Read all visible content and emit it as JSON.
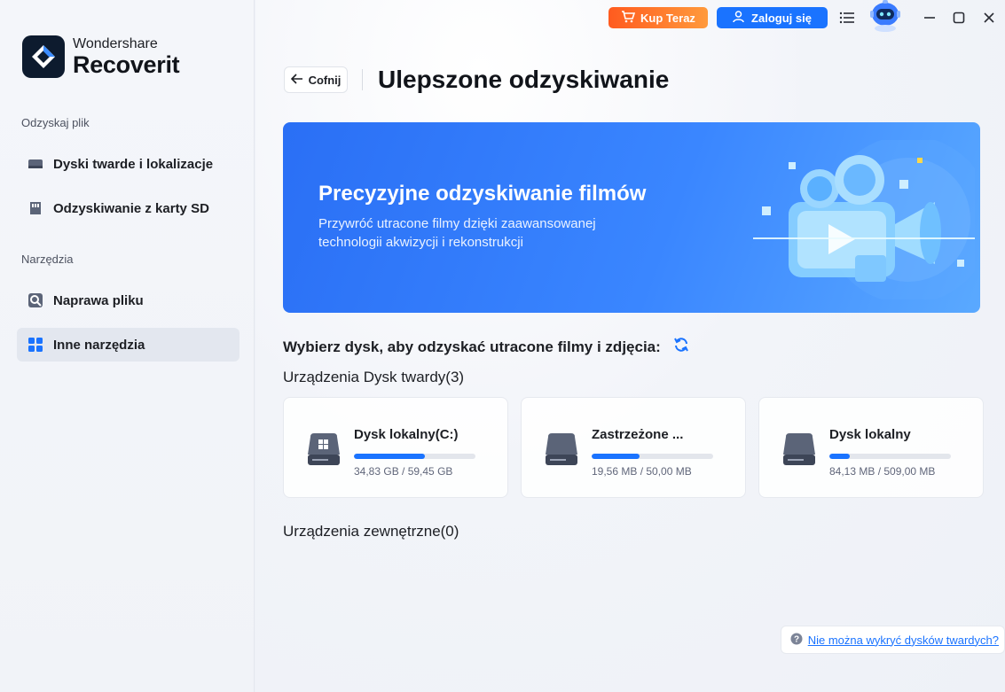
{
  "app": {
    "brand": "Wondershare",
    "product": "Recoverit"
  },
  "sidebar": {
    "section1": "Odzyskaj plik",
    "section2": "Narzędzia",
    "items": [
      {
        "label": "Dyski twarde i lokalizacje",
        "icon": "hard-drive-icon"
      },
      {
        "label": "Odzyskiwanie z karty SD",
        "icon": "sd-card-icon"
      },
      {
        "label": "Naprawa pliku",
        "icon": "file-repair-icon"
      },
      {
        "label": "Inne narzędzia",
        "icon": "grid-tools-icon",
        "active": true
      }
    ]
  },
  "topbar": {
    "buy_label": "Kup Teraz",
    "login_label": "Zaloguj się"
  },
  "header": {
    "back_label": "Cofnij",
    "title": "Ulepszone odzyskiwanie"
  },
  "banner": {
    "title": "Precyzyjne odzyskiwanie filmów",
    "subtitle": "Przywróć utracone filmy dzięki zaawansowanej technologii akwizycji i rekonstrukcji"
  },
  "main": {
    "select_prompt": "Wybierz dysk, aby odzyskać utracone filmy i zdjęcia:",
    "hdd_group": "Urządzenia Dysk twardy(3)",
    "external_group": "Urządzenia zewnętrzne(0)",
    "help_link": "Nie można wykryć dysków twardych?"
  },
  "disks": [
    {
      "name": "Dysk lokalny(C:)",
      "size": "34,83 GB / 59,45 GB",
      "used_fraction": 0.586,
      "icon": "windows-drive-icon"
    },
    {
      "name": "Zastrzeżone ...",
      "size": "19,56 MB / 50,00 MB",
      "used_fraction": 0.391,
      "icon": "drive-icon"
    },
    {
      "name": "Dysk lokalny",
      "size": "84,13 MB / 509,00 MB",
      "used_fraction": 0.165,
      "icon": "drive-icon"
    }
  ],
  "colors": {
    "accent": "#1a73ff",
    "buy_gradient_start": "#ff5b1f",
    "buy_gradient_end": "#ff9a3c",
    "banner": "#3a86ff"
  }
}
